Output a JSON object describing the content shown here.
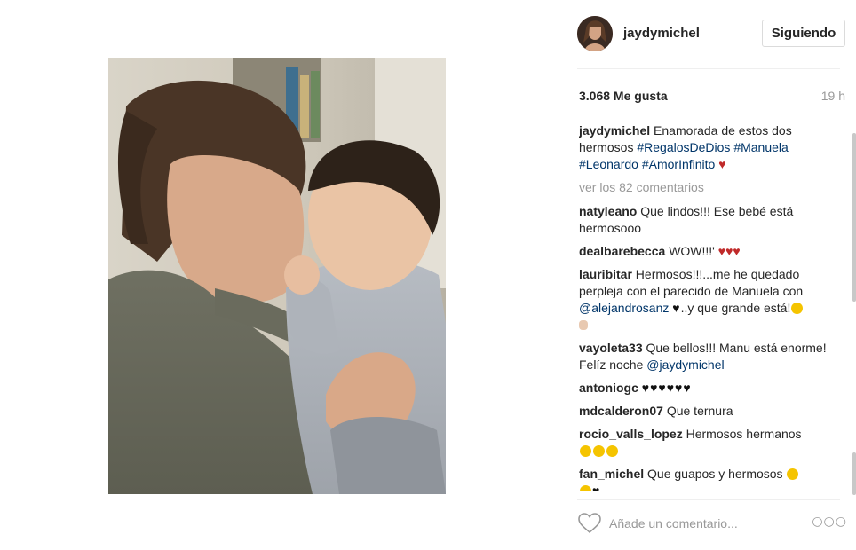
{
  "post": {
    "photo_alt": "photo-woman-and-baby",
    "header": {
      "username": "jaydymichel",
      "follow_label": "Siguiendo"
    },
    "likes": "3.068 Me gusta",
    "time": "19 h",
    "caption": {
      "user": "jaydymichel",
      "text": "Enamorada de estos dos hermosos",
      "tags": [
        "#RegalosDeDios",
        "#Manuela",
        "#Leonardo",
        "#AmorInfinito"
      ],
      "heart": "♥"
    },
    "load_more": "ver los 82 comentarios",
    "comments": [
      {
        "user": "natyleano",
        "text": "Que lindos!!! Ese bebé está hermosooo"
      },
      {
        "user": "dealbarebecca",
        "text": "WOW!!!'",
        "suffix": "♥♥♥"
      },
      {
        "user": "lauribitar",
        "text": "Hermosos!!!...me he quedado perpleja con el parecido de Manuela con",
        "mention": "@alejandrosanz",
        "text2": "..y que grande está!"
      },
      {
        "user": "vayoleta33",
        "text": "Que bellos!!! Manu está enorme! Felíz noche",
        "mention": "@jaydymichel"
      },
      {
        "user": "antoniogc",
        "suffix": "♥♥♥♥♥♥"
      },
      {
        "user": "mdcalderon07",
        "text": "Que ternura"
      },
      {
        "user": "rocio_valls_lopez",
        "text": "Hermosos hermanos"
      },
      {
        "user": "fan_michel",
        "text": "Que guapos y hermosos"
      }
    ],
    "add_comment_placeholder": "Añade un comentario...",
    "more_options": "○○○"
  }
}
